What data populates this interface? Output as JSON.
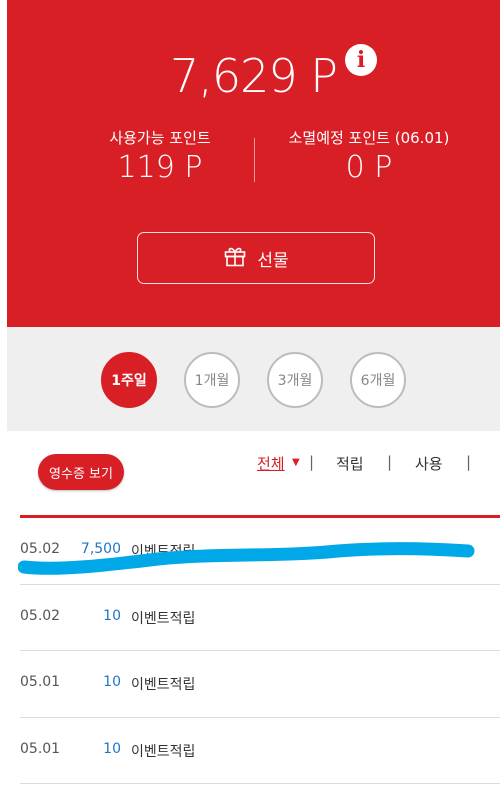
{
  "summary": {
    "total_points": "7,629 P",
    "info_icon": "i",
    "available_label": "사용가능 포인트",
    "available_value": "119 P",
    "expiring_label": "소멸예정 포인트 (06.01)",
    "expiring_value": "0 P",
    "gift_label": "선물"
  },
  "period_tabs": [
    {
      "label": "1주일",
      "active": true
    },
    {
      "label": "1개월",
      "active": false
    },
    {
      "label": "3개월",
      "active": false
    },
    {
      "label": "6개월",
      "active": false
    }
  ],
  "receipt_button": "영수증 보기",
  "filters": {
    "all": "전체",
    "caret": "▼",
    "separator": "|",
    "earn": "적립",
    "use": "사용"
  },
  "transactions": [
    {
      "date": "05.02",
      "points": "7,500",
      "description": "이벤트적립"
    },
    {
      "date": "05.02",
      "points": "10",
      "description": "이벤트적립"
    },
    {
      "date": "05.01",
      "points": "10",
      "description": "이벤트적립"
    },
    {
      "date": "05.01",
      "points": "10",
      "description": "이벤트적립"
    }
  ],
  "colors": {
    "brand_red": "#d91f26",
    "point_blue": "#1f75c9",
    "redaction_blue": "#00a8e8"
  }
}
